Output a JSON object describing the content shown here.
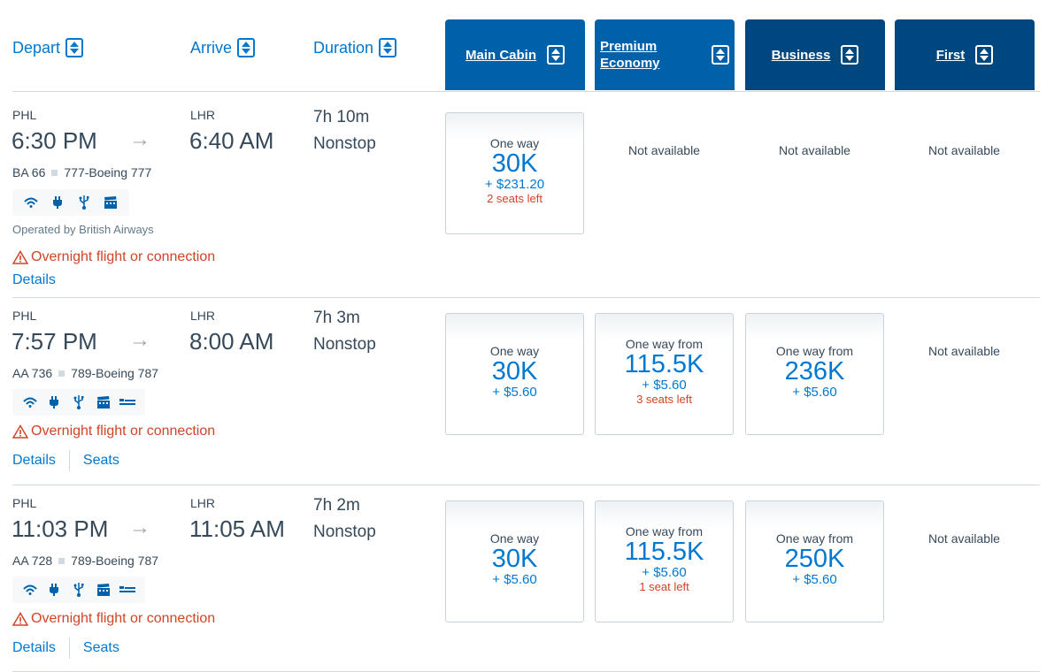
{
  "header": {
    "sort_columns": [
      {
        "label": "Depart"
      },
      {
        "label": "Arrive"
      },
      {
        "label": "Duration"
      }
    ],
    "cabins": [
      {
        "label": "Main Cabin",
        "color": "#0061ab"
      },
      {
        "label_line1": "Premium",
        "label_line2": "Economy",
        "color": "#0061ab"
      },
      {
        "label": "Business",
        "color": "#00467f"
      },
      {
        "label": "First",
        "color": "#00467f"
      }
    ]
  },
  "flights": [
    {
      "origin": "PHL",
      "depart_time": "6:30 PM",
      "destination": "LHR",
      "arrive_time": "6:40 AM",
      "duration": "7h 10m",
      "stops": "Nonstop",
      "flight_number": "BA 66",
      "aircraft": "777-Boeing 777",
      "amenities": [
        "wifi-icon",
        "power-icon",
        "usb-icon",
        "entertainment-icon"
      ],
      "operated_by": "Operated by British Airways",
      "warning": "Overnight flight or connection",
      "links": [
        "Details"
      ],
      "fares": [
        {
          "available": true,
          "label": "One way",
          "miles": "30K",
          "fee": "+ $231.20",
          "seats_left": "2 seats left"
        },
        {
          "available": false,
          "text": "Not available"
        },
        {
          "available": false,
          "text": "Not available"
        },
        {
          "available": false,
          "text": "Not available"
        }
      ]
    },
    {
      "origin": "PHL",
      "depart_time": "7:57 PM",
      "destination": "LHR",
      "arrive_time": "8:00 AM",
      "duration": "7h 3m",
      "stops": "Nonstop",
      "flight_number": "AA 736",
      "aircraft": "789-Boeing 787",
      "amenities": [
        "wifi-icon",
        "power-icon",
        "usb-icon",
        "entertainment-icon",
        "lie-flat-seat-icon"
      ],
      "warning": "Overnight flight or connection",
      "links": [
        "Details",
        "Seats"
      ],
      "fares": [
        {
          "available": true,
          "label": "One way",
          "miles": "30K",
          "fee": "+ $5.60",
          "seats_left": ""
        },
        {
          "available": true,
          "label": "One way from",
          "miles": "115.5K",
          "fee": "+ $5.60",
          "seats_left": "3 seats left"
        },
        {
          "available": true,
          "label": "One way from",
          "miles": "236K",
          "fee": "+ $5.60",
          "seats_left": ""
        },
        {
          "available": false,
          "text": "Not available"
        }
      ]
    },
    {
      "origin": "PHL",
      "depart_time": "11:03 PM",
      "destination": "LHR",
      "arrive_time": "11:05 AM",
      "duration": "7h 2m",
      "stops": "Nonstop",
      "flight_number": "AA 728",
      "aircraft": "789-Boeing 787",
      "amenities": [
        "wifi-icon",
        "power-icon",
        "usb-icon",
        "entertainment-icon",
        "lie-flat-seat-icon"
      ],
      "warning": "Overnight flight or connection",
      "links": [
        "Details",
        "Seats"
      ],
      "fares": [
        {
          "available": true,
          "label": "One way",
          "miles": "30K",
          "fee": "+ $5.60",
          "seats_left": ""
        },
        {
          "available": true,
          "label": "One way from",
          "miles": "115.5K",
          "fee": "+ $5.60",
          "seats_left": "1 seat left"
        },
        {
          "available": true,
          "label": "One way from",
          "miles": "250K",
          "fee": "+ $5.60",
          "seats_left": ""
        },
        {
          "available": false,
          "text": "Not available"
        }
      ]
    }
  ],
  "colors": {
    "link_blue": "#0078d2",
    "warning_orange": "#d14424",
    "text_dark": "#36495a"
  }
}
